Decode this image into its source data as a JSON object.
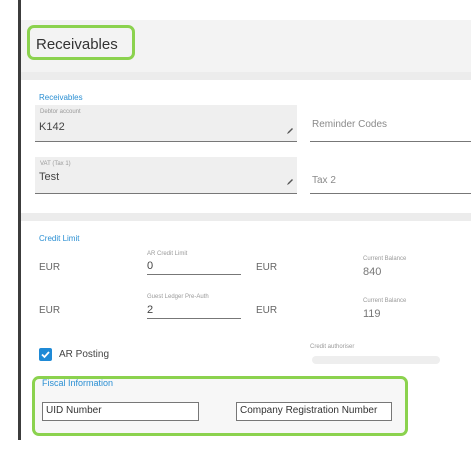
{
  "page": {
    "title": "Receivables"
  },
  "receivables": {
    "section_label": "Receivables",
    "debtor_account_label": "Debtor account",
    "debtor_account_value": "K142",
    "reminder_codes_placeholder": "Reminder Codes",
    "vat_label": "VAT (Tax 1)",
    "vat_value": "Test",
    "tax2_placeholder": "Tax 2"
  },
  "credit_limit": {
    "section_label": "Credit Limit",
    "row1": {
      "currency_left": "EUR",
      "field_label": "AR Credit Limit",
      "field_value": "0",
      "currency_right": "EUR",
      "balance_label": "Current Balance",
      "balance_value": "840"
    },
    "row2": {
      "currency_left": "EUR",
      "field_label": "Guest Ledger Pre-Auth",
      "field_value": "2",
      "currency_right": "EUR",
      "balance_label": "Current Balance",
      "balance_value": "119"
    },
    "ar_posting_label": "AR Posting",
    "ar_posting_checked": true,
    "credit_authoriser_label": "Credit authoriser"
  },
  "fiscal": {
    "title": "Fiscal Information",
    "uid_value": "UID Number",
    "company_reg_value": "Company Registration Number"
  },
  "colors": {
    "accent": "#2a8fd3",
    "highlight": "#8bd24e",
    "checkbox": "#1f8ad6"
  },
  "icons": {
    "edit": "pencil-icon",
    "check": "checkmark-icon"
  }
}
